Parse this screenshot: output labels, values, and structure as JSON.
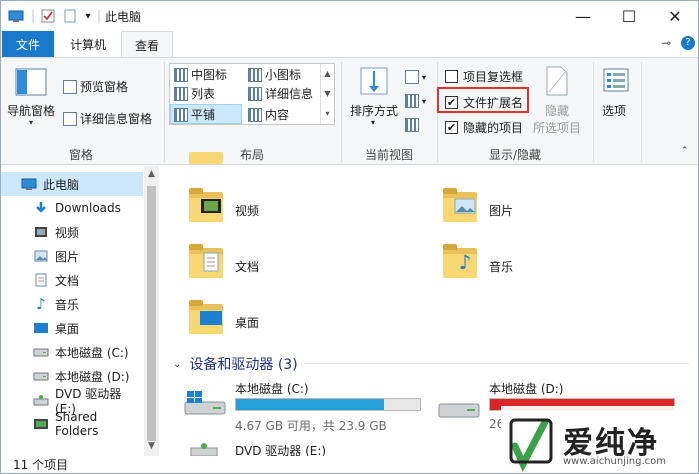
{
  "title_bar": {
    "title": "此电脑",
    "quick_access_dropdown": "▾",
    "buttons": {
      "minimize": "—",
      "maximize": "☐",
      "close": "✕"
    }
  },
  "tabs": {
    "file": "文件",
    "computer": "计算机",
    "view": "查看",
    "pin": "⊸",
    "help": "?"
  },
  "ribbon": {
    "panes": {
      "title": "窗格",
      "nav_pane": "导航窗格",
      "preview_pane": "预览窗格",
      "details_pane": "详细信息窗格"
    },
    "layout": {
      "title": "布局",
      "items": [
        "中图标",
        "小图标",
        "列表",
        "详细信息",
        "平铺",
        "内容"
      ],
      "selected": "平铺"
    },
    "current_view": {
      "title": "当前视图",
      "sort_by": "排序方式"
    },
    "show_hide": {
      "title": "显示/隐藏",
      "item_checkboxes": {
        "label": "项目复选框",
        "checked": false
      },
      "file_extensions": {
        "label": "文件扩展名",
        "checked": true
      },
      "hidden_items": {
        "label": "隐藏的项目",
        "checked": true
      },
      "hide_selected": "隐藏",
      "hide_selected_2": "所选项目",
      "options": "选项"
    }
  },
  "nav_pane": {
    "items": [
      {
        "label": "此电脑",
        "icon": "computer-icon",
        "selected": true
      },
      {
        "label": "Downloads",
        "icon": "download-icon"
      },
      {
        "label": "视频",
        "icon": "video-icon"
      },
      {
        "label": "图片",
        "icon": "picture-icon"
      },
      {
        "label": "文档",
        "icon": "document-icon"
      },
      {
        "label": "音乐",
        "icon": "music-icon"
      },
      {
        "label": "桌面",
        "icon": "desktop-icon"
      },
      {
        "label": "本地磁盘 (C:)",
        "icon": "drive-icon"
      },
      {
        "label": "本地磁盘 (D:)",
        "icon": "drive-icon"
      },
      {
        "label": "DVD 驱动器 (E:)",
        "icon": "dvd-icon"
      },
      {
        "label": "Shared Folders",
        "icon": "shared-folder-icon"
      }
    ]
  },
  "folders": [
    {
      "label": "视频",
      "icon": "video-icon"
    },
    {
      "label": "图片",
      "icon": "picture-icon"
    },
    {
      "label": "文档",
      "icon": "document-icon"
    },
    {
      "label": "音乐",
      "icon": "music-icon"
    },
    {
      "label": "桌面",
      "icon": "desktop-icon"
    }
  ],
  "devices": {
    "header": "设备和驱动器 (3)",
    "drives": [
      {
        "label": "本地磁盘 (C:)",
        "detail": "4.67 GB 可用，共 23.9 GB",
        "used_fraction": 0.805,
        "bar_color": "#26a0da"
      },
      {
        "label": "本地磁盘 (D:)",
        "detail": "26",
        "used_fraction": 1.0,
        "bar_color": "#da2626"
      },
      {
        "label": "DVD 驱动器 (E:)"
      }
    ]
  },
  "status_bar": {
    "item_count": "11 个项目"
  },
  "watermark": {
    "text": "爱纯净",
    "url": "www.aichunjing.com"
  },
  "colors": {
    "accent": "#1979ca",
    "selection": "#cce8ff",
    "highlight_box": "#e0322d"
  }
}
